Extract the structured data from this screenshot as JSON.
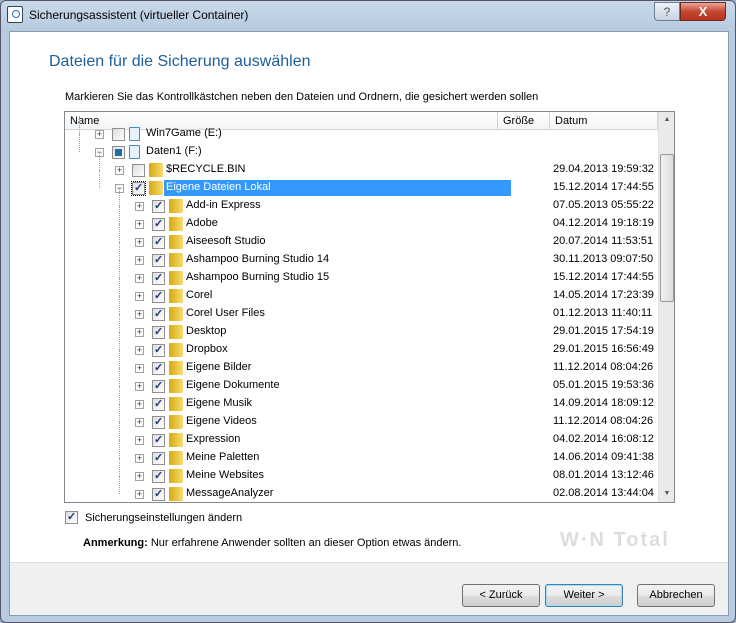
{
  "window": {
    "title": "Sicherungsassistent (virtueller Container)",
    "help": "?",
    "close": "X"
  },
  "heading": "Dateien für die Sicherung auswählen",
  "instruction": "Markieren Sie das Kontrollkästchen neben den Dateien und Ordnern, die gesichert werden sollen",
  "columns": {
    "name": "Name",
    "size": "Größe",
    "date": "Datum"
  },
  "tree": [
    {
      "level": 0,
      "type": "drive",
      "label": "Win7Game (E:)",
      "check": "off",
      "expander": "+",
      "date": ""
    },
    {
      "level": 0,
      "type": "drive",
      "label": "Daten1 (F:)",
      "check": "partial",
      "expander": "-",
      "date": ""
    },
    {
      "level": 1,
      "type": "folder",
      "label": "$RECYCLE.BIN",
      "check": "off",
      "expander": "+",
      "date": "29.04.2013 19:59:32"
    },
    {
      "level": 1,
      "type": "folder",
      "label": "Eigene Dateien Lokal",
      "check": "on",
      "expander": "-",
      "date": "15.12.2014 17:44:55",
      "selected": true
    },
    {
      "level": 2,
      "type": "folder",
      "label": "Add-in Express",
      "check": "on",
      "expander": "+",
      "date": "07.05.2013 05:55:22"
    },
    {
      "level": 2,
      "type": "folder",
      "label": "Adobe",
      "check": "on",
      "expander": "+",
      "date": "04.12.2014 19:18:19"
    },
    {
      "level": 2,
      "type": "folder",
      "label": "Aiseesoft Studio",
      "check": "on",
      "expander": "+",
      "date": "20.07.2014 11:53:51"
    },
    {
      "level": 2,
      "type": "folder",
      "label": "Ashampoo Burning Studio 14",
      "check": "on",
      "expander": "+",
      "date": "30.11.2013 09:07:50"
    },
    {
      "level": 2,
      "type": "folder",
      "label": "Ashampoo Burning Studio 15",
      "check": "on",
      "expander": "+",
      "date": "15.12.2014 17:44:55"
    },
    {
      "level": 2,
      "type": "folder",
      "label": "Corel",
      "check": "on",
      "expander": "+",
      "date": "14.05.2014 17:23:39"
    },
    {
      "level": 2,
      "type": "folder",
      "label": "Corel User Files",
      "check": "on",
      "expander": "+",
      "date": "01.12.2013 11:40:11"
    },
    {
      "level": 2,
      "type": "folder",
      "label": "Desktop",
      "check": "on",
      "expander": "+",
      "date": "29.01.2015 17:54:19"
    },
    {
      "level": 2,
      "type": "folder",
      "label": "Dropbox",
      "check": "on",
      "expander": "+",
      "date": "29.01.2015 16:56:49"
    },
    {
      "level": 2,
      "type": "folder",
      "label": "Eigene Bilder",
      "check": "on",
      "expander": "+",
      "date": "11.12.2014 08:04:26"
    },
    {
      "level": 2,
      "type": "folder",
      "label": "Eigene Dokumente",
      "check": "on",
      "expander": "+",
      "date": "05.01.2015 19:53:36"
    },
    {
      "level": 2,
      "type": "folder",
      "label": "Eigene Musik",
      "check": "on",
      "expander": "+",
      "date": "14.09.2014 18:09:12"
    },
    {
      "level": 2,
      "type": "folder",
      "label": "Eigene Videos",
      "check": "on",
      "expander": "+",
      "date": "11.12.2014 08:04:26"
    },
    {
      "level": 2,
      "type": "folder",
      "label": "Expression",
      "check": "on",
      "expander": "+",
      "date": "04.02.2014 16:08:12"
    },
    {
      "level": 2,
      "type": "folder",
      "label": "Meine Paletten",
      "check": "on",
      "expander": "+",
      "date": "14.06.2014 09:41:38"
    },
    {
      "level": 2,
      "type": "folder",
      "label": "Meine Websites",
      "check": "on",
      "expander": "+",
      "date": "08.01.2014 13:12:46"
    },
    {
      "level": 2,
      "type": "folder",
      "label": "MessageAnalyzer",
      "check": "on",
      "expander": "+",
      "date": "02.08.2014 13:44:04"
    }
  ],
  "option": {
    "label": "Sicherungseinstellungen ändern",
    "checked": true
  },
  "note": {
    "bold": "Anmerkung:",
    "text": " Nur erfahrene Anwender sollten an dieser Option etwas ändern."
  },
  "watermark": "WinTotal",
  "buttons": {
    "back": "< Zurück",
    "next": "Weiter >",
    "cancel": "Abbrechen"
  }
}
